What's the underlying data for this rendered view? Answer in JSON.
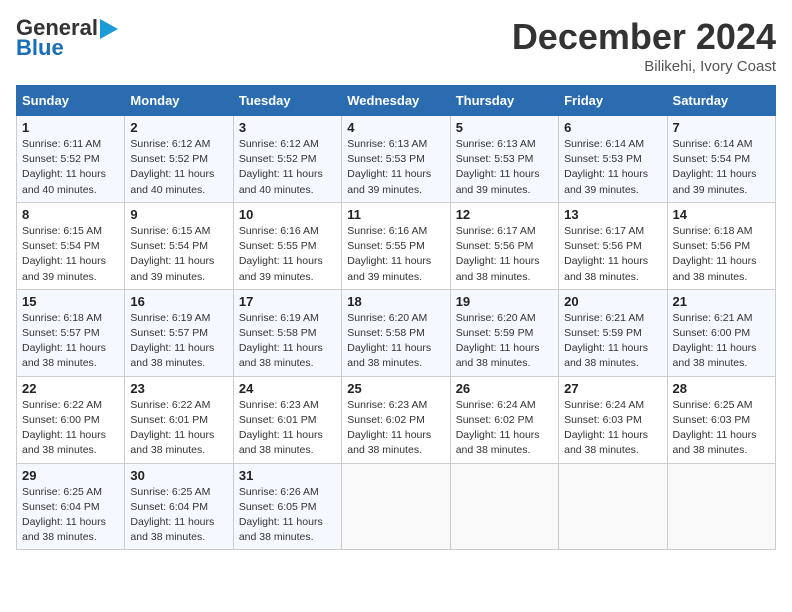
{
  "header": {
    "logo_line1": "General",
    "logo_line2": "Blue",
    "month": "December 2024",
    "location": "Bilikehi, Ivory Coast"
  },
  "weekdays": [
    "Sunday",
    "Monday",
    "Tuesday",
    "Wednesday",
    "Thursday",
    "Friday",
    "Saturday"
  ],
  "weeks": [
    [
      {
        "day": "1",
        "info": "Sunrise: 6:11 AM\nSunset: 5:52 PM\nDaylight: 11 hours\nand 40 minutes."
      },
      {
        "day": "2",
        "info": "Sunrise: 6:12 AM\nSunset: 5:52 PM\nDaylight: 11 hours\nand 40 minutes."
      },
      {
        "day": "3",
        "info": "Sunrise: 6:12 AM\nSunset: 5:52 PM\nDaylight: 11 hours\nand 40 minutes."
      },
      {
        "day": "4",
        "info": "Sunrise: 6:13 AM\nSunset: 5:53 PM\nDaylight: 11 hours\nand 39 minutes."
      },
      {
        "day": "5",
        "info": "Sunrise: 6:13 AM\nSunset: 5:53 PM\nDaylight: 11 hours\nand 39 minutes."
      },
      {
        "day": "6",
        "info": "Sunrise: 6:14 AM\nSunset: 5:53 PM\nDaylight: 11 hours\nand 39 minutes."
      },
      {
        "day": "7",
        "info": "Sunrise: 6:14 AM\nSunset: 5:54 PM\nDaylight: 11 hours\nand 39 minutes."
      }
    ],
    [
      {
        "day": "8",
        "info": "Sunrise: 6:15 AM\nSunset: 5:54 PM\nDaylight: 11 hours\nand 39 minutes."
      },
      {
        "day": "9",
        "info": "Sunrise: 6:15 AM\nSunset: 5:54 PM\nDaylight: 11 hours\nand 39 minutes."
      },
      {
        "day": "10",
        "info": "Sunrise: 6:16 AM\nSunset: 5:55 PM\nDaylight: 11 hours\nand 39 minutes."
      },
      {
        "day": "11",
        "info": "Sunrise: 6:16 AM\nSunset: 5:55 PM\nDaylight: 11 hours\nand 39 minutes."
      },
      {
        "day": "12",
        "info": "Sunrise: 6:17 AM\nSunset: 5:56 PM\nDaylight: 11 hours\nand 38 minutes."
      },
      {
        "day": "13",
        "info": "Sunrise: 6:17 AM\nSunset: 5:56 PM\nDaylight: 11 hours\nand 38 minutes."
      },
      {
        "day": "14",
        "info": "Sunrise: 6:18 AM\nSunset: 5:56 PM\nDaylight: 11 hours\nand 38 minutes."
      }
    ],
    [
      {
        "day": "15",
        "info": "Sunrise: 6:18 AM\nSunset: 5:57 PM\nDaylight: 11 hours\nand 38 minutes."
      },
      {
        "day": "16",
        "info": "Sunrise: 6:19 AM\nSunset: 5:57 PM\nDaylight: 11 hours\nand 38 minutes."
      },
      {
        "day": "17",
        "info": "Sunrise: 6:19 AM\nSunset: 5:58 PM\nDaylight: 11 hours\nand 38 minutes."
      },
      {
        "day": "18",
        "info": "Sunrise: 6:20 AM\nSunset: 5:58 PM\nDaylight: 11 hours\nand 38 minutes."
      },
      {
        "day": "19",
        "info": "Sunrise: 6:20 AM\nSunset: 5:59 PM\nDaylight: 11 hours\nand 38 minutes."
      },
      {
        "day": "20",
        "info": "Sunrise: 6:21 AM\nSunset: 5:59 PM\nDaylight: 11 hours\nand 38 minutes."
      },
      {
        "day": "21",
        "info": "Sunrise: 6:21 AM\nSunset: 6:00 PM\nDaylight: 11 hours\nand 38 minutes."
      }
    ],
    [
      {
        "day": "22",
        "info": "Sunrise: 6:22 AM\nSunset: 6:00 PM\nDaylight: 11 hours\nand 38 minutes."
      },
      {
        "day": "23",
        "info": "Sunrise: 6:22 AM\nSunset: 6:01 PM\nDaylight: 11 hours\nand 38 minutes."
      },
      {
        "day": "24",
        "info": "Sunrise: 6:23 AM\nSunset: 6:01 PM\nDaylight: 11 hours\nand 38 minutes."
      },
      {
        "day": "25",
        "info": "Sunrise: 6:23 AM\nSunset: 6:02 PM\nDaylight: 11 hours\nand 38 minutes."
      },
      {
        "day": "26",
        "info": "Sunrise: 6:24 AM\nSunset: 6:02 PM\nDaylight: 11 hours\nand 38 minutes."
      },
      {
        "day": "27",
        "info": "Sunrise: 6:24 AM\nSunset: 6:03 PM\nDaylight: 11 hours\nand 38 minutes."
      },
      {
        "day": "28",
        "info": "Sunrise: 6:25 AM\nSunset: 6:03 PM\nDaylight: 11 hours\nand 38 minutes."
      }
    ],
    [
      {
        "day": "29",
        "info": "Sunrise: 6:25 AM\nSunset: 6:04 PM\nDaylight: 11 hours\nand 38 minutes."
      },
      {
        "day": "30",
        "info": "Sunrise: 6:25 AM\nSunset: 6:04 PM\nDaylight: 11 hours\nand 38 minutes."
      },
      {
        "day": "31",
        "info": "Sunrise: 6:26 AM\nSunset: 6:05 PM\nDaylight: 11 hours\nand 38 minutes."
      },
      null,
      null,
      null,
      null
    ]
  ]
}
